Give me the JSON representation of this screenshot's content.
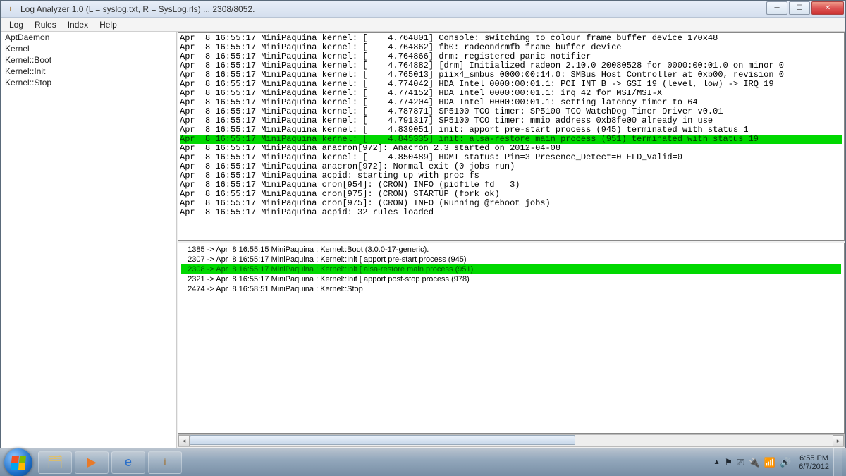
{
  "window": {
    "title": "Log Analyzer 1.0 (L = syslog.txt, R = SysLog.rls) ... 2308/8052."
  },
  "menu": {
    "items": [
      "Log",
      "Rules",
      "Index",
      "Help"
    ]
  },
  "sidebar": {
    "items": [
      "AptDaemon",
      "Kernel",
      "Kernel::Boot",
      "Kernel::Init",
      "Kernel::Stop"
    ]
  },
  "log": {
    "lines": [
      "Apr  8 16:55:17 MiniPaquina kernel: [    4.764801] Console: switching to colour frame buffer device 170x48",
      "Apr  8 16:55:17 MiniPaquina kernel: [    4.764862] fb0: radeondrmfb frame buffer device",
      "Apr  8 16:55:17 MiniPaquina kernel: [    4.764866] drm: registered panic notifier",
      "Apr  8 16:55:17 MiniPaquina kernel: [    4.764882] [drm] Initialized radeon 2.10.0 20080528 for 0000:00:01.0 on minor 0",
      "Apr  8 16:55:17 MiniPaquina kernel: [    4.765013] piix4_smbus 0000:00:14.0: SMBus Host Controller at 0xb00, revision 0",
      "Apr  8 16:55:17 MiniPaquina kernel: [    4.774042] HDA Intel 0000:00:01.1: PCI INT B -> GSI 19 (level, low) -> IRQ 19",
      "Apr  8 16:55:17 MiniPaquina kernel: [    4.774152] HDA Intel 0000:00:01.1: irq 42 for MSI/MSI-X",
      "Apr  8 16:55:17 MiniPaquina kernel: [    4.774204] HDA Intel 0000:00:01.1: setting latency timer to 64",
      "Apr  8 16:55:17 MiniPaquina kernel: [    4.787871] SP5100 TCO timer: SP5100 TCO WatchDog Timer Driver v0.01",
      "Apr  8 16:55:17 MiniPaquina kernel: [    4.791317] SP5100 TCO timer: mmio address 0xb8fe00 already in use",
      "Apr  8 16:55:17 MiniPaquina kernel: [    4.839051] init: apport pre-start process (945) terminated with status 1",
      "Apr  8 16:55:17 MiniPaquina kernel: [    4.845335] init: alsa-restore main process (951) terminated with status 19",
      "Apr  8 16:55:17 MiniPaquina anacron[972]: Anacron 2.3 started on 2012-04-08",
      "Apr  8 16:55:17 MiniPaquina kernel: [    4.850489] HDMI status: Pin=3 Presence_Detect=0 ELD_Valid=0",
      "Apr  8 16:55:17 MiniPaquina anacron[972]: Normal exit (0 jobs run)",
      "Apr  8 16:55:17 MiniPaquina acpid: starting up with proc fs",
      "Apr  8 16:55:17 MiniPaquina cron[954]: (CRON) INFO (pidfile fd = 3)",
      "Apr  8 16:55:17 MiniPaquina cron[975]: (CRON) STARTUP (fork ok)",
      "Apr  8 16:55:17 MiniPaquina cron[975]: (CRON) INFO (Running @reboot jobs)",
      "Apr  8 16:55:17 MiniPaquina acpid: 32 rules loaded"
    ],
    "highlight_index": 11
  },
  "hits": {
    "lines": [
      "1385 -> Apr  8 16:55:15 MiniPaquina : Kernel::Boot (3.0.0-17-generic).",
      "2307 -> Apr  8 16:55:17 MiniPaquina : Kernel::Init [ apport pre-start process (945)",
      "2308 -> Apr  8 16:55:17 MiniPaquina : Kernel::Init [ alsa-restore main process (951)",
      "2321 -> Apr  8 16:55:17 MiniPaquina : Kernel::Init [ apport post-stop process (978)",
      "2474 -> Apr  8 16:58:51 MiniPaquina : Kernel::Stop"
    ],
    "selected_index": 2
  },
  "tray": {
    "time": "6:55 PM",
    "date": "6/7/2012"
  }
}
